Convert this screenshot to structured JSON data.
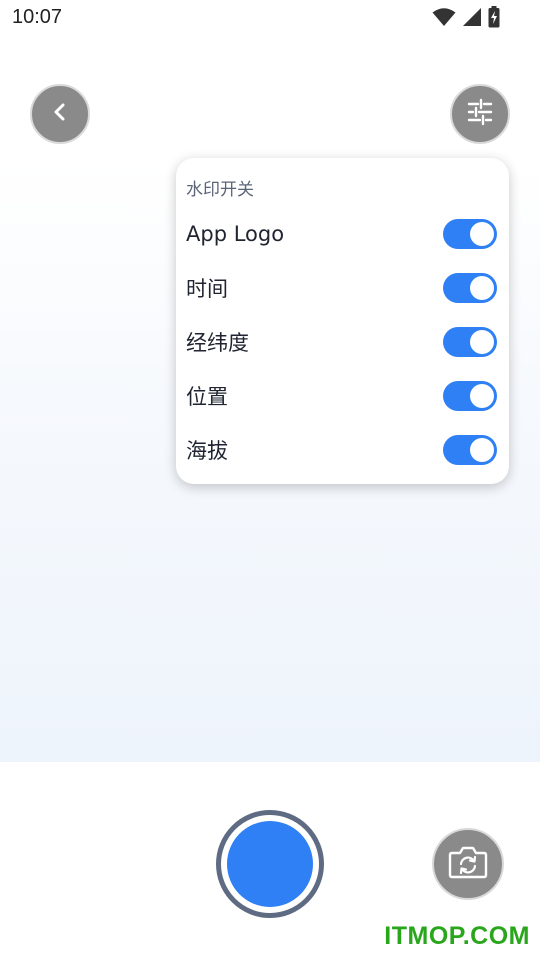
{
  "status_bar": {
    "time": "10:07",
    "icons": [
      "wifi-icon",
      "cell-signal-icon",
      "battery-charging-icon"
    ]
  },
  "top_bar": {
    "back_icon": "chevron-left-icon",
    "settings_icon": "sliders-icon"
  },
  "watermark_panel": {
    "title": "水印开关",
    "toggles": [
      {
        "label": "App Logo",
        "on": true
      },
      {
        "label": "时间",
        "on": true
      },
      {
        "label": "经纬度",
        "on": true
      },
      {
        "label": "位置",
        "on": true
      },
      {
        "label": "海拔",
        "on": true
      }
    ]
  },
  "bottom_bar": {
    "shutter_icon": "shutter-button",
    "flip_icon": "camera-flip-icon"
  },
  "site_watermark": "ITMOP.COM",
  "colors": {
    "accent": "#2f7ff5",
    "button_gray": "#8a8a8a",
    "shutter_ring": "#5e6b82",
    "watermark_green": "#2aa61d"
  }
}
